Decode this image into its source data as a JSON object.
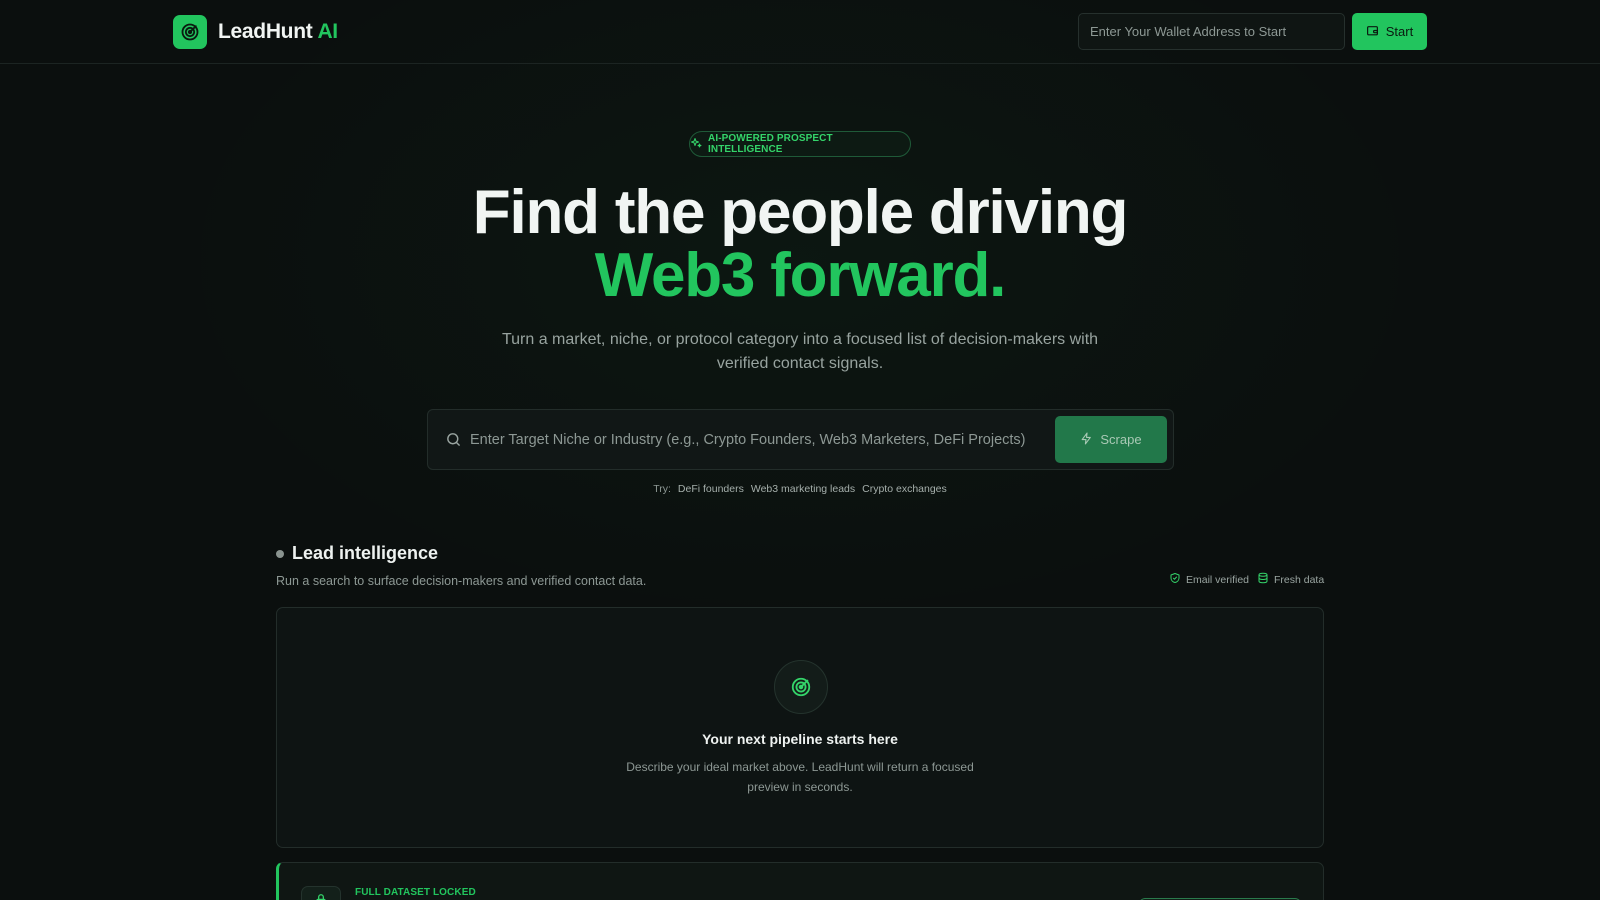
{
  "header": {
    "brand_name": "LeadHunt",
    "brand_suffix": "AI",
    "wallet_placeholder": "Enter Your Wallet Address to Start",
    "start_label": "Start"
  },
  "hero": {
    "badge": "AI-POWERED PROSPECT INTELLIGENCE",
    "headline_line1": "Find the people driving",
    "headline_line2": "Web3 forward.",
    "subtext": "Turn a market, niche, or protocol category into a focused list of decision-makers with verified contact signals."
  },
  "search": {
    "placeholder": "Enter Target Niche or Industry (e.g., Crypto Founders, Web3 Marketers, DeFi Projects)",
    "button_label": "Scrape",
    "try_label": "Try:",
    "suggestions": [
      "DeFi founders",
      "Web3 marketing leads",
      "Crypto exchanges"
    ]
  },
  "lead_section": {
    "title": "Lead intelligence",
    "subtitle": "Run a search to surface decision-makers and verified contact data.",
    "badges": [
      "Email verified",
      "Fresh data"
    ],
    "empty_title": "Your next pipeline starts here",
    "empty_desc": "Describe your ideal market above. LeadHunt will return a focused preview in seconds."
  },
  "locked": {
    "label": "FULL DATASET LOCKED"
  },
  "colors": {
    "accent": "#22c55e",
    "background": "#0b0f0e",
    "scrape_button": "#22784a"
  },
  "icons": {
    "logo": "target-icon",
    "wallet": "wallet-icon",
    "badge": "sparkles-icon",
    "search": "search-icon",
    "scrape": "lightning-icon",
    "email_verified": "shield-check-icon",
    "fresh_data": "database-icon",
    "empty_state": "target-icon",
    "locked": "lock-icon"
  }
}
